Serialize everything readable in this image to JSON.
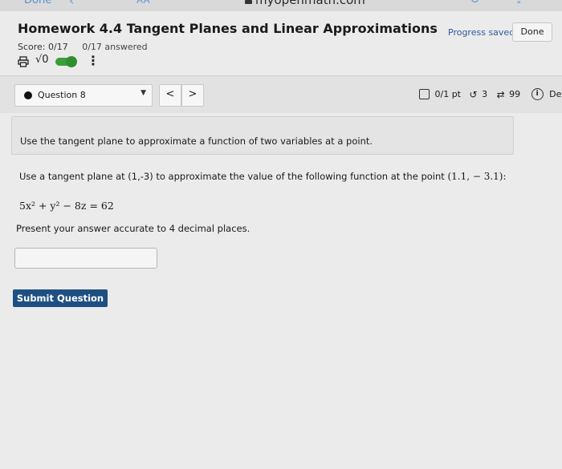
{
  "browser": {
    "done_label": "Done",
    "aa_label": "AA",
    "url": "myopenmath.com"
  },
  "header": {
    "title": "Homework 4.4 Tangent Planes and Linear Approximations",
    "progress_saved": "Progress saved",
    "done_button": "Done",
    "score": "Score: 0/17",
    "answered": "0/17 answered",
    "math_toggle_label": "√0"
  },
  "question_bar": {
    "question_label": "Question 8",
    "prev_label": "<",
    "next_label": ">",
    "points": "0/1 pt",
    "retries": "3",
    "attempts": "99",
    "details_label": "Details"
  },
  "question": {
    "description": "Use the tangent plane to approximate a function of two variables at a point.",
    "prompt_text": "Use a tangent plane at (1,-3) to approximate the value of the following function at the point",
    "prompt_point": "(1.1, − 3.1):",
    "equation": "5x² + y² − 8z = 62",
    "instruction": "Present your answer accurate to 4 decimal places.",
    "answer_value": "",
    "submit_label": "Submit Question"
  },
  "colors": {
    "accent": "#1e4f82",
    "progress_saved": "#2c5aa0",
    "toggle_on": "#3a9e3a"
  }
}
